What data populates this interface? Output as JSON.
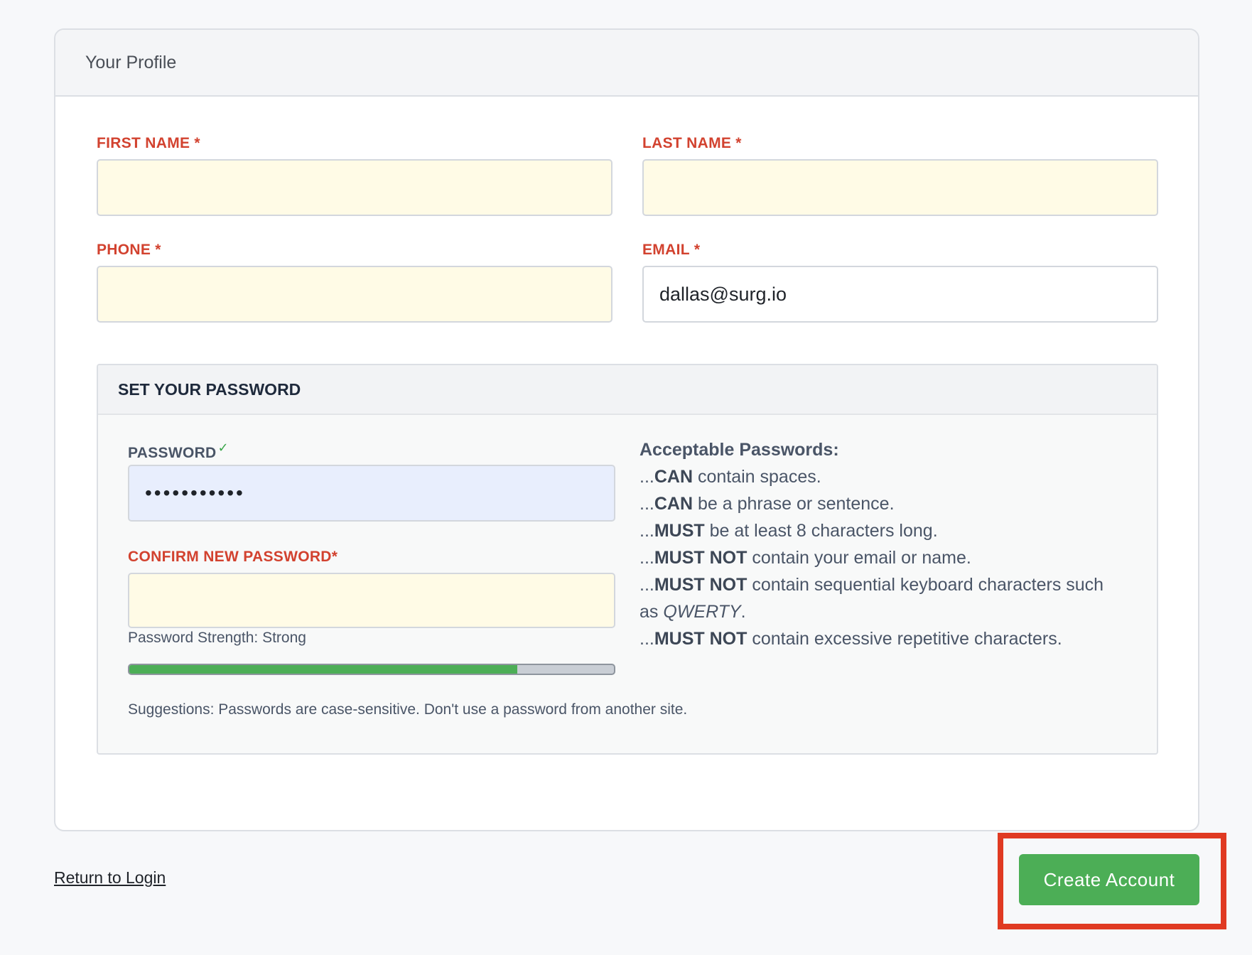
{
  "card": {
    "title": "Your Profile"
  },
  "fields": {
    "first_name": {
      "label": "FIRST NAME",
      "required": "*",
      "value": ""
    },
    "last_name": {
      "label": "LAST NAME",
      "required": "*",
      "value": ""
    },
    "phone": {
      "label": "PHONE",
      "required": "*",
      "value": ""
    },
    "email": {
      "label": "EMAIL",
      "required": "*",
      "value": "dallas@surg.io"
    }
  },
  "password_section": {
    "title": "SET YOUR PASSWORD",
    "password_label": "PASSWORD",
    "password_check": "✓",
    "password_value": "•••••••••••",
    "confirm_label": "CONFIRM NEW PASSWORD*",
    "confirm_value": "",
    "strength_text": "Password Strength: Strong",
    "strength_fraction": 0.8,
    "suggestions": "Suggestions: Passwords are case-sensitive. Don't use a password from another site.",
    "rules_title": "Acceptable Passwords:",
    "rules": [
      {
        "prefix": "...",
        "bold": "CAN",
        "rest": " contain spaces."
      },
      {
        "prefix": "...",
        "bold": "CAN",
        "rest": " be a phrase or sentence."
      },
      {
        "prefix": "...",
        "bold": "MUST",
        "rest": " be at least 8 characters long."
      },
      {
        "prefix": "...",
        "bold": "MUST NOT",
        "rest": " contain your email or name."
      },
      {
        "prefix": "...",
        "bold": "MUST NOT",
        "rest": " contain sequential keyboard characters such as ",
        "italic": "QWERTY",
        "tail": "."
      },
      {
        "prefix": "...",
        "bold": "MUST NOT",
        "rest": " contain excessive repetitive characters."
      }
    ]
  },
  "footer": {
    "return_link": "Return to Login",
    "create_button": "Create Account"
  },
  "colors": {
    "required_label": "#d2422f",
    "button_green": "#4cae56",
    "highlight_red": "#e03a22",
    "input_yellow": "#fffbe6",
    "input_blue": "#e8eefd"
  }
}
